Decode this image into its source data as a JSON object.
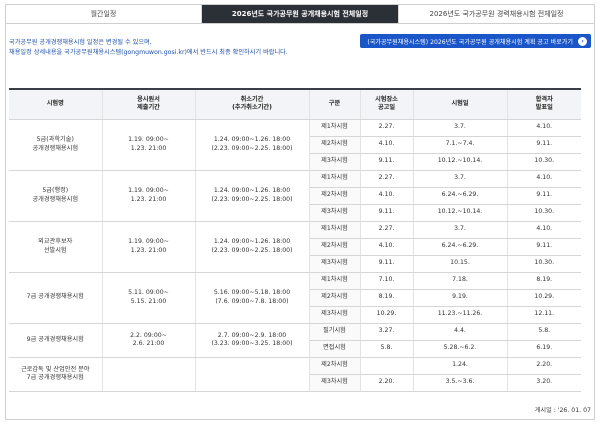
{
  "tabs": [
    {
      "label": "월간일정"
    },
    {
      "label": "2026년도 국가공무원 공개채용시험 전체일정"
    },
    {
      "label": "2026년도 국가공무원 경력채용시험 전체일정"
    }
  ],
  "notice": {
    "line1": "국가공무원 공개경쟁채용시험 일정은 변경될 수 있으며,",
    "line2": "채용일정 상세내용을 국가공무원채용시스템(gongmuwon.gosi.kr)에서 반드시 최종 확인하시기 바랍니다."
  },
  "link_button": {
    "label": "(국가공무원채용시스템) 2026년도 국가공무원 공개채용시험 계획 공고 바로가기",
    "icon": "chevron-right-icon"
  },
  "table": {
    "headers": {
      "exam": "시험명",
      "application": [
        "응시원서",
        "제출기간"
      ],
      "cancel": [
        "취소기간",
        "(추가취소기간)"
      ],
      "stage": "구분",
      "venue": [
        "시험장소",
        "공고일"
      ],
      "test_date": "시험일",
      "result": [
        "합격자",
        "발표일"
      ]
    },
    "groups": [
      {
        "name": [
          "5급(과학기술)",
          "공개경쟁채용시험"
        ],
        "application": [
          "1.19. 09:00~",
          "1.23. 21:00"
        ],
        "cancel": [
          "1.24. 09:00~1.26. 18:00",
          "(2.23. 09:00~2.25. 18:00)"
        ],
        "rows": [
          {
            "stage": "제1차시험",
            "venue": "2.27.",
            "test": "3.7.",
            "result": "4.10."
          },
          {
            "stage": "제2차시험",
            "venue": "4.10.",
            "test": "7.1.~7.4.",
            "result": "9.11."
          },
          {
            "stage": "제3차시험",
            "venue": "9.11.",
            "test": "10.12.~10.14.",
            "result": "10.30."
          }
        ]
      },
      {
        "name": [
          "5급(행정)",
          "공개경쟁채용시험"
        ],
        "application": [
          "1.19. 09:00~",
          "1.23. 21:00"
        ],
        "cancel": [
          "1.24. 09:00~1.26. 18:00",
          "(2.23. 09:00~2.25. 18:00)"
        ],
        "rows": [
          {
            "stage": "제1차시험",
            "venue": "2.27.",
            "test": "3.7.",
            "result": "4.10."
          },
          {
            "stage": "제2차시험",
            "venue": "4.10.",
            "test": "6.24.~6.29.",
            "result": "9.11."
          },
          {
            "stage": "제3차시험",
            "venue": "9.11.",
            "test": "10.12.~10.14.",
            "result": "10.30."
          }
        ]
      },
      {
        "name": [
          "외교관후보자",
          "선발시험"
        ],
        "application": [
          "1.19. 09:00~",
          "1.23. 21:00"
        ],
        "cancel": [
          "1.24. 09:00~1.26. 18:00",
          "(2.23. 09:00~2.25. 18:00)"
        ],
        "rows": [
          {
            "stage": "제1차시험",
            "venue": "2.27.",
            "test": "3.7.",
            "result": "4.10."
          },
          {
            "stage": "제2차시험",
            "venue": "4.10.",
            "test": "6.24.~6.29.",
            "result": "9.11."
          },
          {
            "stage": "제3차시험",
            "venue": "9.11.",
            "test": "10.15.",
            "result": "10.30."
          }
        ]
      },
      {
        "name": [
          "7급 공개경쟁채용시험"
        ],
        "application": [
          "5.11. 09:00~",
          "5.15. 21:00"
        ],
        "cancel": [
          "5.16. 09:00~5.18. 18:00",
          "(7.6. 09:00~7.8. 18:00)"
        ],
        "rows": [
          {
            "stage": "제1차시험",
            "venue": "7.10.",
            "test": "7.18.",
            "result": "8.19."
          },
          {
            "stage": "제2차시험",
            "venue": "8.19.",
            "test": "9.19.",
            "result": "10.29."
          },
          {
            "stage": "제3차시험",
            "venue": "10.29.",
            "test": "11.23.~11.26.",
            "result": "12.11."
          }
        ]
      },
      {
        "name": [
          "9급 공개경쟁채용시험"
        ],
        "application": [
          "2.2. 09:00~",
          "2.6. 21:00"
        ],
        "cancel": [
          "2.7. 09:00~2.9. 18:00",
          "(3.23. 09:00~3.25. 18:00)"
        ],
        "rows": [
          {
            "stage": "필기시험",
            "venue": "3.27.",
            "test": "4.4.",
            "result": "5.8."
          },
          {
            "stage": "면접시험",
            "venue": "5.8.",
            "test": "5.28.~6.2.",
            "result": "6.19."
          }
        ]
      },
      {
        "name": [
          "근로감독 및 산업안전 분야",
          "7급 공개경쟁채용시험"
        ],
        "application": [],
        "cancel": [],
        "rows": [
          {
            "stage": "제2차시험",
            "venue": "",
            "test": "1.24.",
            "result": "2.20."
          },
          {
            "stage": "제3차시험",
            "venue": "2.20.",
            "test": "3.5.~3.6.",
            "result": "3.20."
          }
        ]
      }
    ]
  },
  "footnote": "게시일 : '26. 01. 07"
}
